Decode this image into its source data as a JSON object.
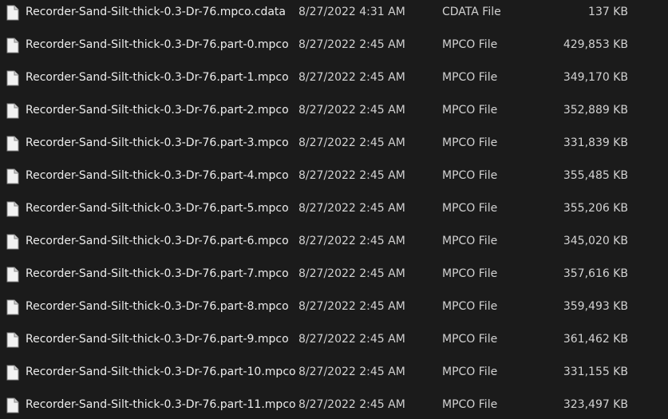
{
  "files": [
    {
      "name": "Recorder-Sand-Silt-thick-0.3-Dr-76.mpco.cdata",
      "date": "8/27/2022 4:31 AM",
      "type": "CDATA File",
      "size": "137 KB",
      "icon": "file-icon"
    },
    {
      "name": "Recorder-Sand-Silt-thick-0.3-Dr-76.part-0.mpco",
      "date": "8/27/2022 2:45 AM",
      "type": "MPCO File",
      "size": "429,853 KB",
      "icon": "file-icon"
    },
    {
      "name": "Recorder-Sand-Silt-thick-0.3-Dr-76.part-1.mpco",
      "date": "8/27/2022 2:45 AM",
      "type": "MPCO File",
      "size": "349,170 KB",
      "icon": "file-icon"
    },
    {
      "name": "Recorder-Sand-Silt-thick-0.3-Dr-76.part-2.mpco",
      "date": "8/27/2022 2:45 AM",
      "type": "MPCO File",
      "size": "352,889 KB",
      "icon": "file-icon"
    },
    {
      "name": "Recorder-Sand-Silt-thick-0.3-Dr-76.part-3.mpco",
      "date": "8/27/2022 2:45 AM",
      "type": "MPCO File",
      "size": "331,839 KB",
      "icon": "file-icon"
    },
    {
      "name": "Recorder-Sand-Silt-thick-0.3-Dr-76.part-4.mpco",
      "date": "8/27/2022 2:45 AM",
      "type": "MPCO File",
      "size": "355,485 KB",
      "icon": "file-icon"
    },
    {
      "name": "Recorder-Sand-Silt-thick-0.3-Dr-76.part-5.mpco",
      "date": "8/27/2022 2:45 AM",
      "type": "MPCO File",
      "size": "355,206 KB",
      "icon": "file-icon"
    },
    {
      "name": "Recorder-Sand-Silt-thick-0.3-Dr-76.part-6.mpco",
      "date": "8/27/2022 2:45 AM",
      "type": "MPCO File",
      "size": "345,020 KB",
      "icon": "file-icon"
    },
    {
      "name": "Recorder-Sand-Silt-thick-0.3-Dr-76.part-7.mpco",
      "date": "8/27/2022 2:45 AM",
      "type": "MPCO File",
      "size": "357,616 KB",
      "icon": "file-icon"
    },
    {
      "name": "Recorder-Sand-Silt-thick-0.3-Dr-76.part-8.mpco",
      "date": "8/27/2022 2:45 AM",
      "type": "MPCO File",
      "size": "359,493 KB",
      "icon": "file-icon"
    },
    {
      "name": "Recorder-Sand-Silt-thick-0.3-Dr-76.part-9.mpco",
      "date": "8/27/2022 2:45 AM",
      "type": "MPCO File",
      "size": "361,462 KB",
      "icon": "file-icon"
    },
    {
      "name": "Recorder-Sand-Silt-thick-0.3-Dr-76.part-10.mpco",
      "date": "8/27/2022 2:45 AM",
      "type": "MPCO File",
      "size": "331,155 KB",
      "icon": "file-icon"
    },
    {
      "name": "Recorder-Sand-Silt-thick-0.3-Dr-76.part-11.mpco",
      "date": "8/27/2022 2:45 AM",
      "type": "MPCO File",
      "size": "323,497 KB",
      "icon": "file-icon"
    }
  ],
  "colors": {
    "background": "#1b1b1b",
    "text_primary": "#ececec",
    "text_secondary": "#d2d2d2",
    "icon_fill": "#f2f2f2"
  }
}
